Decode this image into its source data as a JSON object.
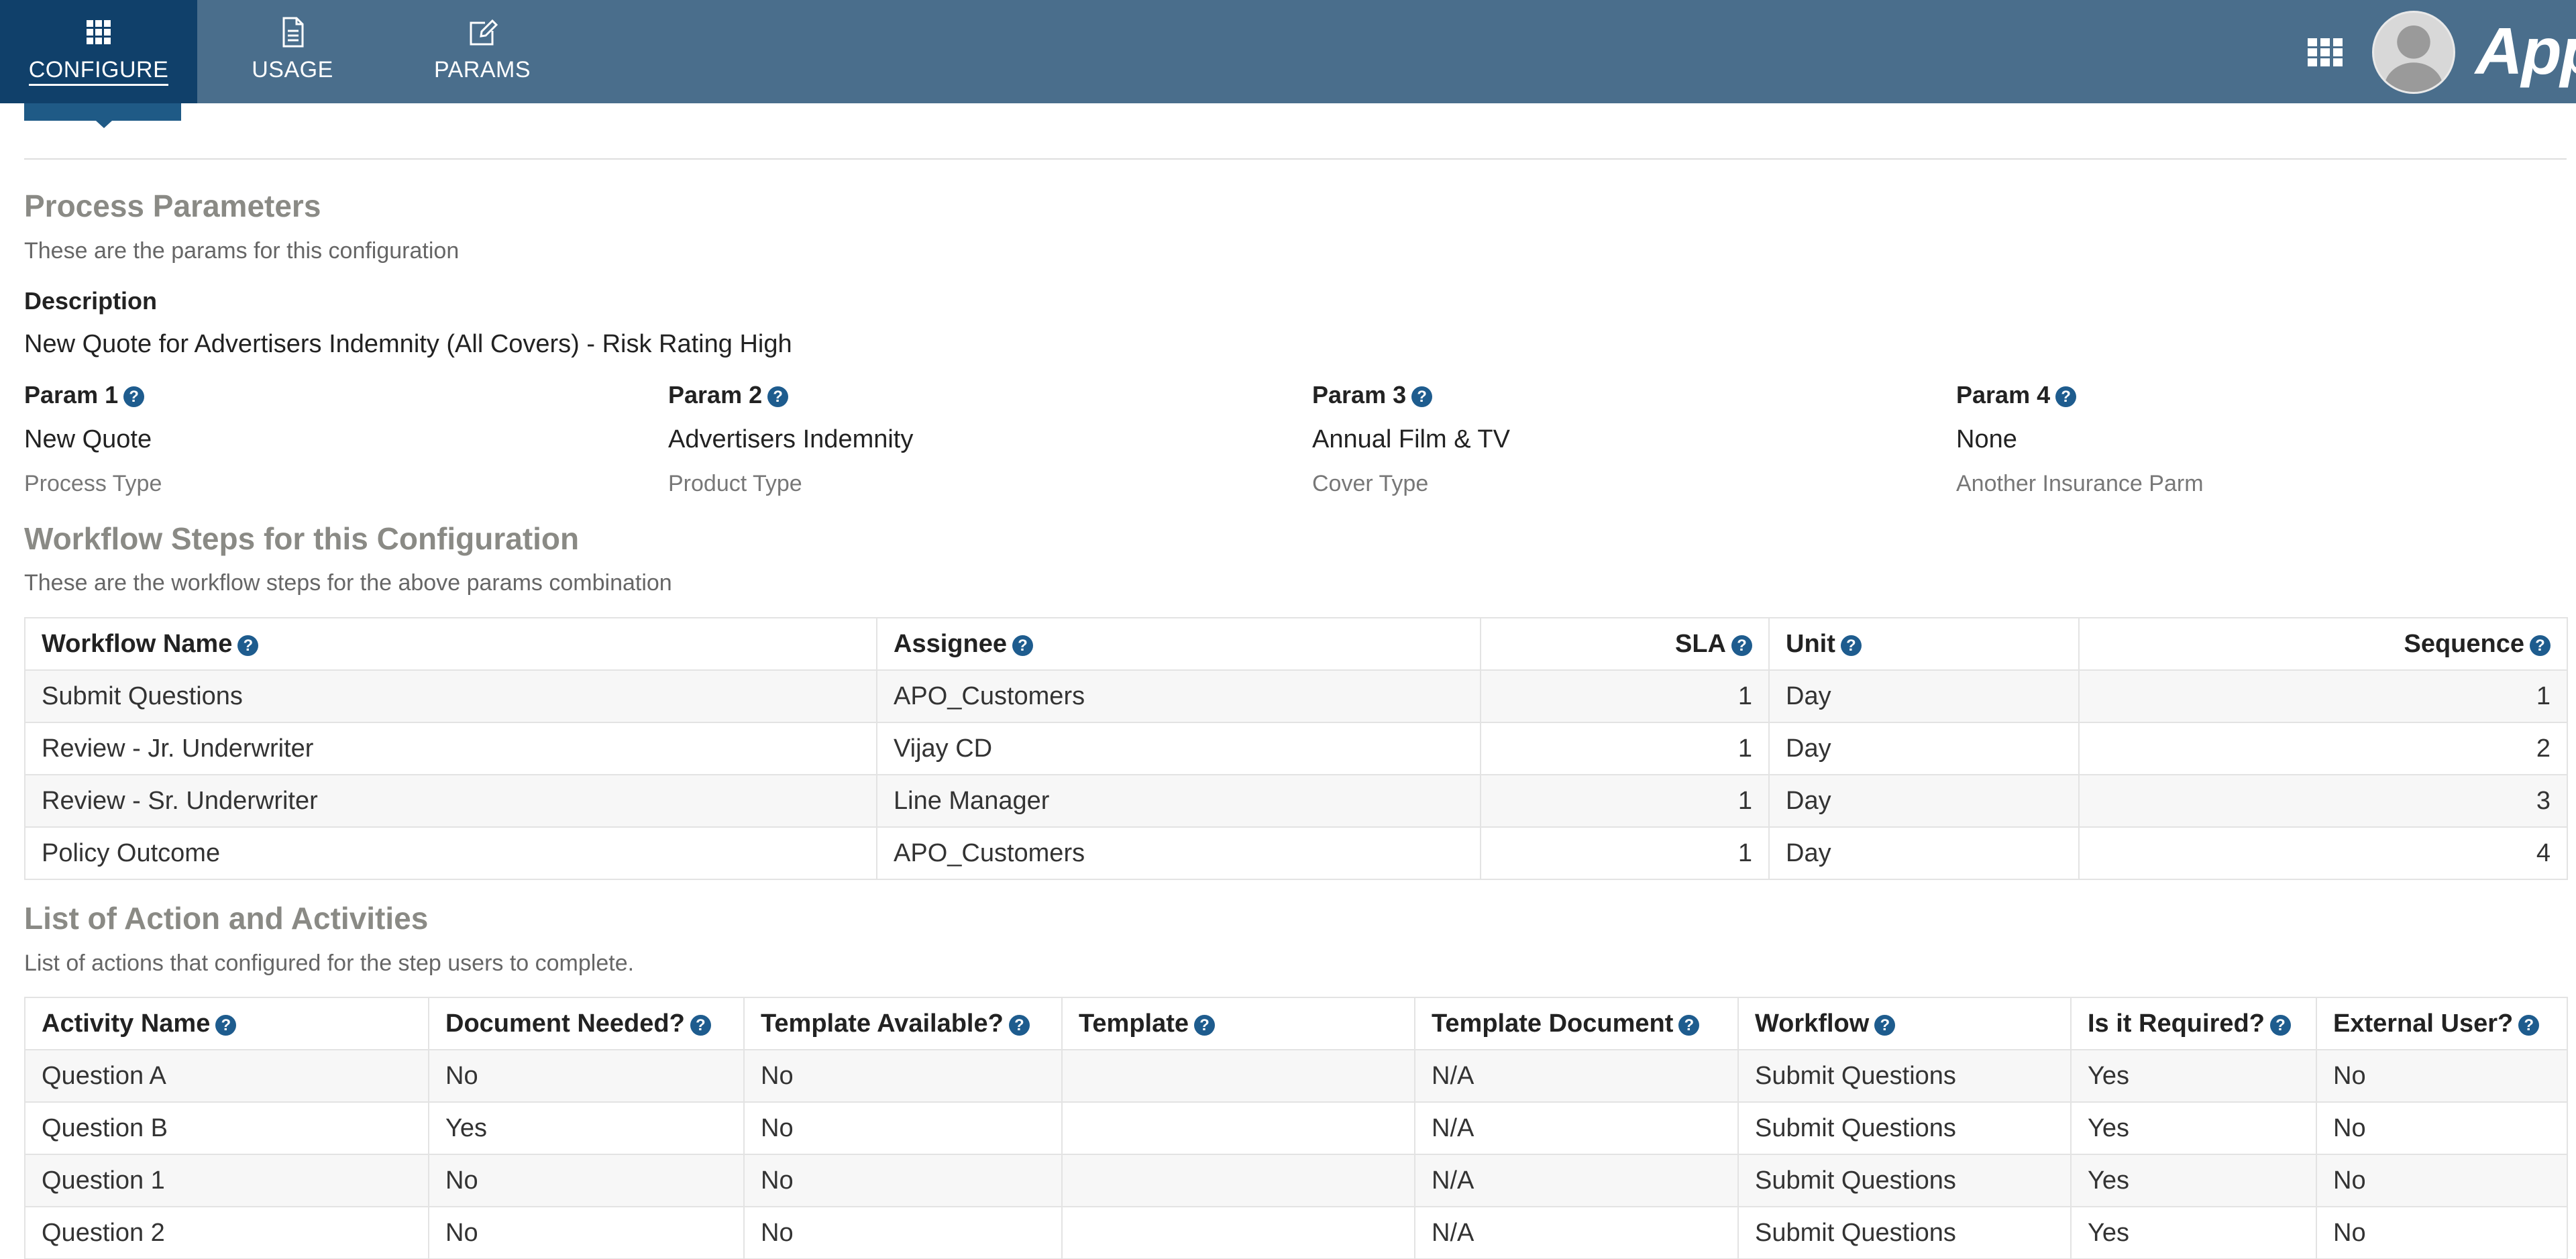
{
  "nav": {
    "tabs": [
      {
        "label": "CONFIGURE",
        "icon": "grid-icon",
        "active": true
      },
      {
        "label": "USAGE",
        "icon": "document-icon",
        "active": false
      },
      {
        "label": "PARAMS",
        "icon": "edit-icon",
        "active": false
      }
    ],
    "brand": "Appia",
    "colors": {
      "bar": "#4a6e8c",
      "active_tab": "#10406a",
      "help_icon": "#1e5c8e"
    }
  },
  "process_parameters": {
    "title": "Process Parameters",
    "description": "These are the params for this configuration",
    "description_label": "Description",
    "description_value": "New Quote for Advertisers Indemnity (All Covers)  - Risk Rating High",
    "params": [
      {
        "label": "Param 1",
        "value": "New Quote",
        "sub": "Process Type"
      },
      {
        "label": "Param 2",
        "value": "Advertisers Indemnity",
        "sub": "Product Type"
      },
      {
        "label": "Param 3",
        "value": "Annual Film & TV",
        "sub": "Cover Type"
      },
      {
        "label": "Param 4",
        "value": "None",
        "sub": "Another Insurance Parm"
      }
    ]
  },
  "workflow_steps": {
    "title": "Workflow Steps for this Configuration",
    "description": "These are the workflow steps for the above params combination",
    "columns": [
      "Workflow Name",
      "Assignee",
      "SLA",
      "Unit",
      "Sequence"
    ],
    "rows": [
      [
        "Submit Questions",
        "APO_Customers",
        "1",
        "Day",
        "1"
      ],
      [
        "Review - Jr. Underwriter",
        "Vijay CD",
        "1",
        "Day",
        "2"
      ],
      [
        "Review - Sr. Underwriter",
        "Line Manager",
        "1",
        "Day",
        "3"
      ],
      [
        "Policy Outcome",
        "APO_Customers",
        "1",
        "Day",
        "4"
      ]
    ]
  },
  "activities": {
    "title": "List of Action and Activities",
    "description": "List of actions that configured for the step users to complete.",
    "columns": [
      "Activity Name",
      "Document Needed?",
      "Template Available?",
      "Template",
      "Template Document",
      "Workflow",
      "Is it Required?",
      "External User?"
    ],
    "rows": [
      [
        "Question A",
        "No",
        "No",
        "",
        "N/A",
        "Submit Questions",
        "Yes",
        "No"
      ],
      [
        "Question B",
        "Yes",
        "No",
        "",
        "N/A",
        "Submit Questions",
        "Yes",
        "No"
      ],
      [
        "Question 1",
        "No",
        "No",
        "",
        "N/A",
        "Submit Questions",
        "Yes",
        "No"
      ],
      [
        "Question 2",
        "No",
        "No",
        "",
        "N/A",
        "Submit Questions",
        "Yes",
        "No"
      ]
    ]
  }
}
